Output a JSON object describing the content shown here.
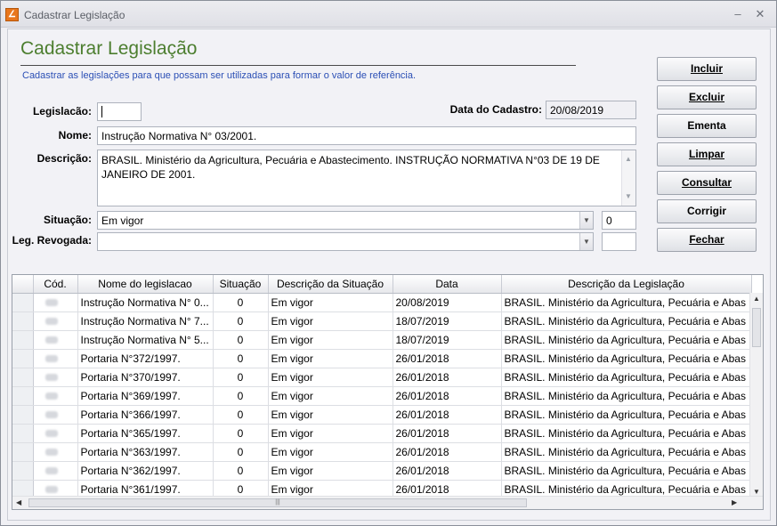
{
  "window": {
    "title": "Cadastrar Legislação",
    "minimize": "–",
    "close": "✕"
  },
  "header": {
    "title": "Cadastrar Legislação",
    "subtitle": "Cadastrar as legislações para que possam ser utilizadas para formar o valor de referência."
  },
  "form": {
    "legislacao_label": "Legislacão:",
    "legislacao_value": "",
    "data_cadastro_label": "Data do Cadastro:",
    "data_cadastro_value": "20/08/2019",
    "nome_label": "Nome:",
    "nome_value": "Instrução Normativa N° 03/2001.",
    "descricao_label": "Descrição:",
    "descricao_value": "BRASIL. Ministério da Agricultura, Pecuária e Abastecimento. INSTRUÇÃO NORMATIVA N°03 DE 19 DE JANEIRO DE 2001.",
    "situacao_label": "Situação:",
    "situacao_value": "Em vigor",
    "situacao_code": "0",
    "leg_revogada_label": "Leg. Revogada:",
    "leg_revogada_value": "",
    "leg_revogada_code": ""
  },
  "buttons": {
    "incluir": "Incluir",
    "excluir": "Excluir",
    "ementa": "Ementa",
    "limpar": "Limpar",
    "consultar": "Consultar",
    "corrigir": "Corrigir",
    "fechar": "Fechar"
  },
  "grid": {
    "columns": [
      "Cód.",
      "Nome do legislacao",
      "Situação",
      "Descrição da Situação",
      "Data",
      "Descrição da Legislação"
    ],
    "rows": [
      [
        "",
        "Instrução Normativa N° 0...",
        "0",
        "Em vigor",
        "20/08/2019",
        "BRASIL. Ministério da Agricultura, Pecuária e Abas"
      ],
      [
        "",
        "Instrução Normativa N° 7...",
        "0",
        "Em vigor",
        "18/07/2019",
        "BRASIL. Ministério da Agricultura, Pecuária e Abas"
      ],
      [
        "",
        "Instrução Normativa N° 5...",
        "0",
        "Em vigor",
        "18/07/2019",
        "BRASIL. Ministério da Agricultura, Pecuária e Abas"
      ],
      [
        "",
        "Portaria N°372/1997.",
        "0",
        "Em vigor",
        "26/01/2018",
        "BRASIL. Ministério da Agricultura, Pecuária e Abas"
      ],
      [
        "",
        "Portaria N°370/1997.",
        "0",
        "Em vigor",
        "26/01/2018",
        "BRASIL. Ministério da Agricultura, Pecuária e Abas"
      ],
      [
        "",
        "Portaria N°369/1997.",
        "0",
        "Em vigor",
        "26/01/2018",
        "BRASIL. Ministério da Agricultura, Pecuária e Abas"
      ],
      [
        "",
        "Portaria N°366/1997.",
        "0",
        "Em vigor",
        "26/01/2018",
        "BRASIL. Ministério da Agricultura, Pecuária e Abas"
      ],
      [
        "",
        "Portaria N°365/1997.",
        "0",
        "Em vigor",
        "26/01/2018",
        "BRASIL. Ministério da Agricultura, Pecuária e Abas"
      ],
      [
        "",
        "Portaria N°363/1997.",
        "0",
        "Em vigor",
        "26/01/2018",
        "BRASIL. Ministério da Agricultura, Pecuária e Abas"
      ],
      [
        "",
        "Portaria N°362/1997.",
        "0",
        "Em vigor",
        "26/01/2018",
        "BRASIL. Ministério da Agricultura, Pecuária e Abas"
      ],
      [
        "",
        "Portaria N°361/1997.",
        "0",
        "Em vigor",
        "26/01/2018",
        "BRASIL. Ministério da Agricultura, Pecuária e Abas"
      ]
    ]
  }
}
